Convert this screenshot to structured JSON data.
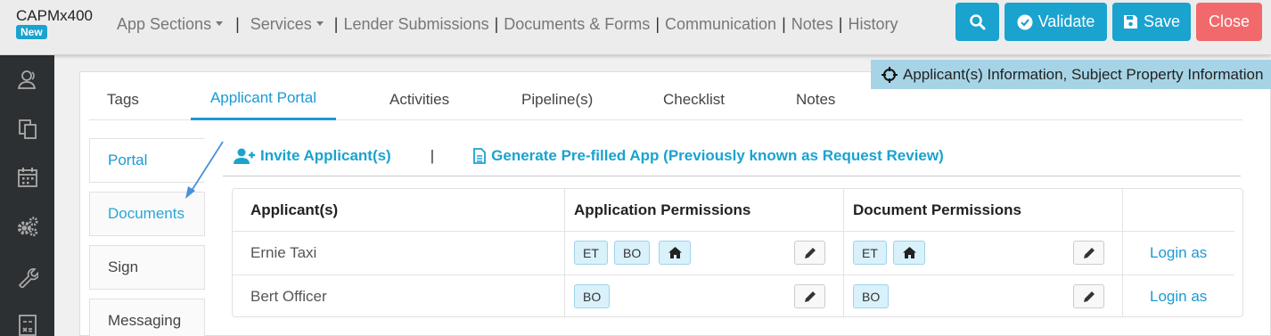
{
  "header": {
    "app_name": "CAPMx400",
    "badge": "New",
    "nav": {
      "app_sections": "App Sections",
      "services": "Services",
      "lender_submissions": "Lender Submissions",
      "documents_forms": "Documents & Forms",
      "communication": "Communication",
      "notes": "Notes",
      "history": "History"
    },
    "buttons": {
      "validate": "Validate",
      "save": "Save",
      "close": "Close"
    }
  },
  "info_banner": "Applicant(s) Information, Subject Property Information",
  "tabs": {
    "tags": "Tags",
    "applicant_portal": "Applicant Portal",
    "activities": "Activities",
    "pipelines": "Pipeline(s)",
    "checklist": "Checklist",
    "notes": "Notes"
  },
  "side_tabs": {
    "portal": "Portal",
    "documents": "Documents",
    "sign": "Sign",
    "messaging": "Messaging"
  },
  "actions": {
    "invite": "Invite Applicant(s)",
    "separator": "|",
    "generate": "Generate Pre-filled App (Previously known as Request Review)"
  },
  "table": {
    "headers": {
      "applicants": "Applicant(s)",
      "app_perms": "Application Permissions",
      "doc_perms": "Document Permissions"
    },
    "rows": [
      {
        "name": "Ernie Taxi",
        "app_chips": [
          "ET",
          "BO"
        ],
        "doc_chips": [
          "ET"
        ],
        "login": "Login as"
      },
      {
        "name": "Bert Officer",
        "app_chips": [
          "BO"
        ],
        "doc_chips": [
          "BO"
        ],
        "login": "Login as"
      }
    ]
  },
  "colors": {
    "accent": "#1aa3cf",
    "close": "#f1696b",
    "sidebar": "#2d3033",
    "banner": "#a6d4e6"
  }
}
